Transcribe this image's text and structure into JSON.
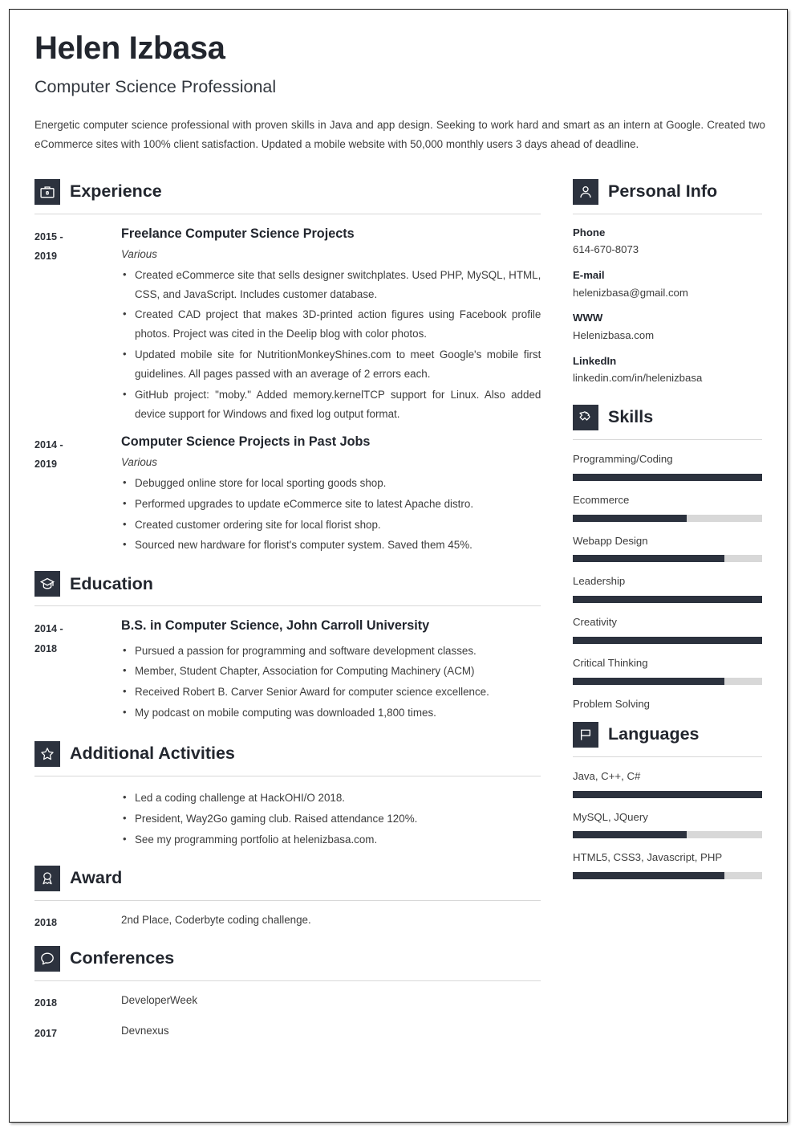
{
  "header": {
    "name": "Helen Izbasa",
    "job_title": "Computer Science Professional",
    "summary": "Energetic computer science professional with proven skills in Java and app design. Seeking to work hard and smart as an intern at Google. Created two eCommerce sites with 100% client satisfaction. Updated a mobile website with 50,000 monthly users 3 days ahead of deadline."
  },
  "sections": {
    "experience": {
      "title": "Experience",
      "icon": "briefcase-icon",
      "entries": [
        {
          "date_line1": "2015 -",
          "date_line2": "2019",
          "title": "Freelance Computer Science Projects",
          "subtitle": "Various",
          "bullets": [
            "Created eCommerce site that sells designer switchplates. Used PHP, MySQL, HTML, CSS, and JavaScript. Includes customer database.",
            "Created CAD project that makes 3D-printed action figures using Facebook profile photos. Project was cited in the Deelip blog with color photos.",
            "Updated mobile site for NutritionMonkeyShines.com to meet Google's mobile first guidelines. All pages passed with an average of 2 errors each.",
            "GitHub project: \"moby.\" Added memory.kernelTCP support for Linux. Also added device support for Windows and fixed log output format."
          ]
        },
        {
          "date_line1": "2014 -",
          "date_line2": "2019",
          "title": "Computer Science Projects in Past Jobs",
          "subtitle": "Various",
          "bullets": [
            "Debugged online store for local sporting goods shop.",
            "Performed upgrades to update eCommerce site to latest Apache distro.",
            "Created customer ordering site for local florist shop.",
            "Sourced new hardware for florist's computer system. Saved them 45%."
          ]
        }
      ]
    },
    "education": {
      "title": "Education",
      "icon": "graduation-cap-icon",
      "entries": [
        {
          "date_line1": "2014 -",
          "date_line2": "2018",
          "title": "B.S. in Computer Science, John Carroll University",
          "bullets": [
            "Pursued a passion for programming and software development classes.",
            "Member, Student Chapter, Association for Computing Machinery (ACM)",
            "Received Robert B. Carver Senior Award for computer science excellence.",
            "My podcast on mobile computing was downloaded 1,800 times."
          ]
        }
      ]
    },
    "additional_activities": {
      "title": "Additional Activities",
      "icon": "star-icon",
      "bullets": [
        "Led a coding challenge at HackOHI/O 2018.",
        "President, Way2Go gaming club. Raised attendance 120%.",
        "See my programming portfolio at helenizbasa.com."
      ]
    },
    "award": {
      "title": "Award",
      "icon": "medal-icon",
      "entries": [
        {
          "date": "2018",
          "text": "2nd Place, Coderbyte coding challenge."
        }
      ]
    },
    "conferences": {
      "title": "Conferences",
      "icon": "speech-bubble-icon",
      "entries": [
        {
          "date": "2018",
          "text": "DeveloperWeek"
        },
        {
          "date": "2017",
          "text": "Devnexus"
        }
      ]
    },
    "personal_info": {
      "title": "Personal Info",
      "icon": "person-icon",
      "fields": [
        {
          "label": "Phone",
          "value": "614-670-8073"
        },
        {
          "label": "E-mail",
          "value": "helenizbasa@gmail.com"
        },
        {
          "label": "WWW",
          "value": "Helenizbasa.com"
        },
        {
          "label": "LinkedIn",
          "value": "linkedin.com/in/helenizbasa"
        }
      ]
    },
    "skills": {
      "title": "Skills",
      "icon": "puzzle-piece-icon",
      "items": [
        {
          "name": "Programming/Coding",
          "level": 100,
          "has_bar": true
        },
        {
          "name": "Ecommerce",
          "level": 60,
          "has_bar": true
        },
        {
          "name": "Webapp Design",
          "level": 80,
          "has_bar": true
        },
        {
          "name": "Leadership",
          "level": 100,
          "has_bar": true
        },
        {
          "name": "Creativity",
          "level": 100,
          "has_bar": true
        },
        {
          "name": "Critical Thinking",
          "level": 80,
          "has_bar": true
        },
        {
          "name": "Problem Solving",
          "level": 0,
          "has_bar": false
        }
      ]
    },
    "languages": {
      "title": "Languages",
      "icon": "flag-icon",
      "items": [
        {
          "name": "Java, C++, C#",
          "level": 100,
          "has_bar": true
        },
        {
          "name": "MySQL, JQuery",
          "level": 60,
          "has_bar": true
        },
        {
          "name": "HTML5, CSS3, Javascript, PHP",
          "level": 80,
          "has_bar": true
        }
      ]
    }
  },
  "colors": {
    "icon_box": "#2c323e",
    "bar_fill": "#2c323e",
    "bar_track": "#d8d8d8",
    "heading": "#22262e",
    "body_text": "#3d3d3d"
  }
}
